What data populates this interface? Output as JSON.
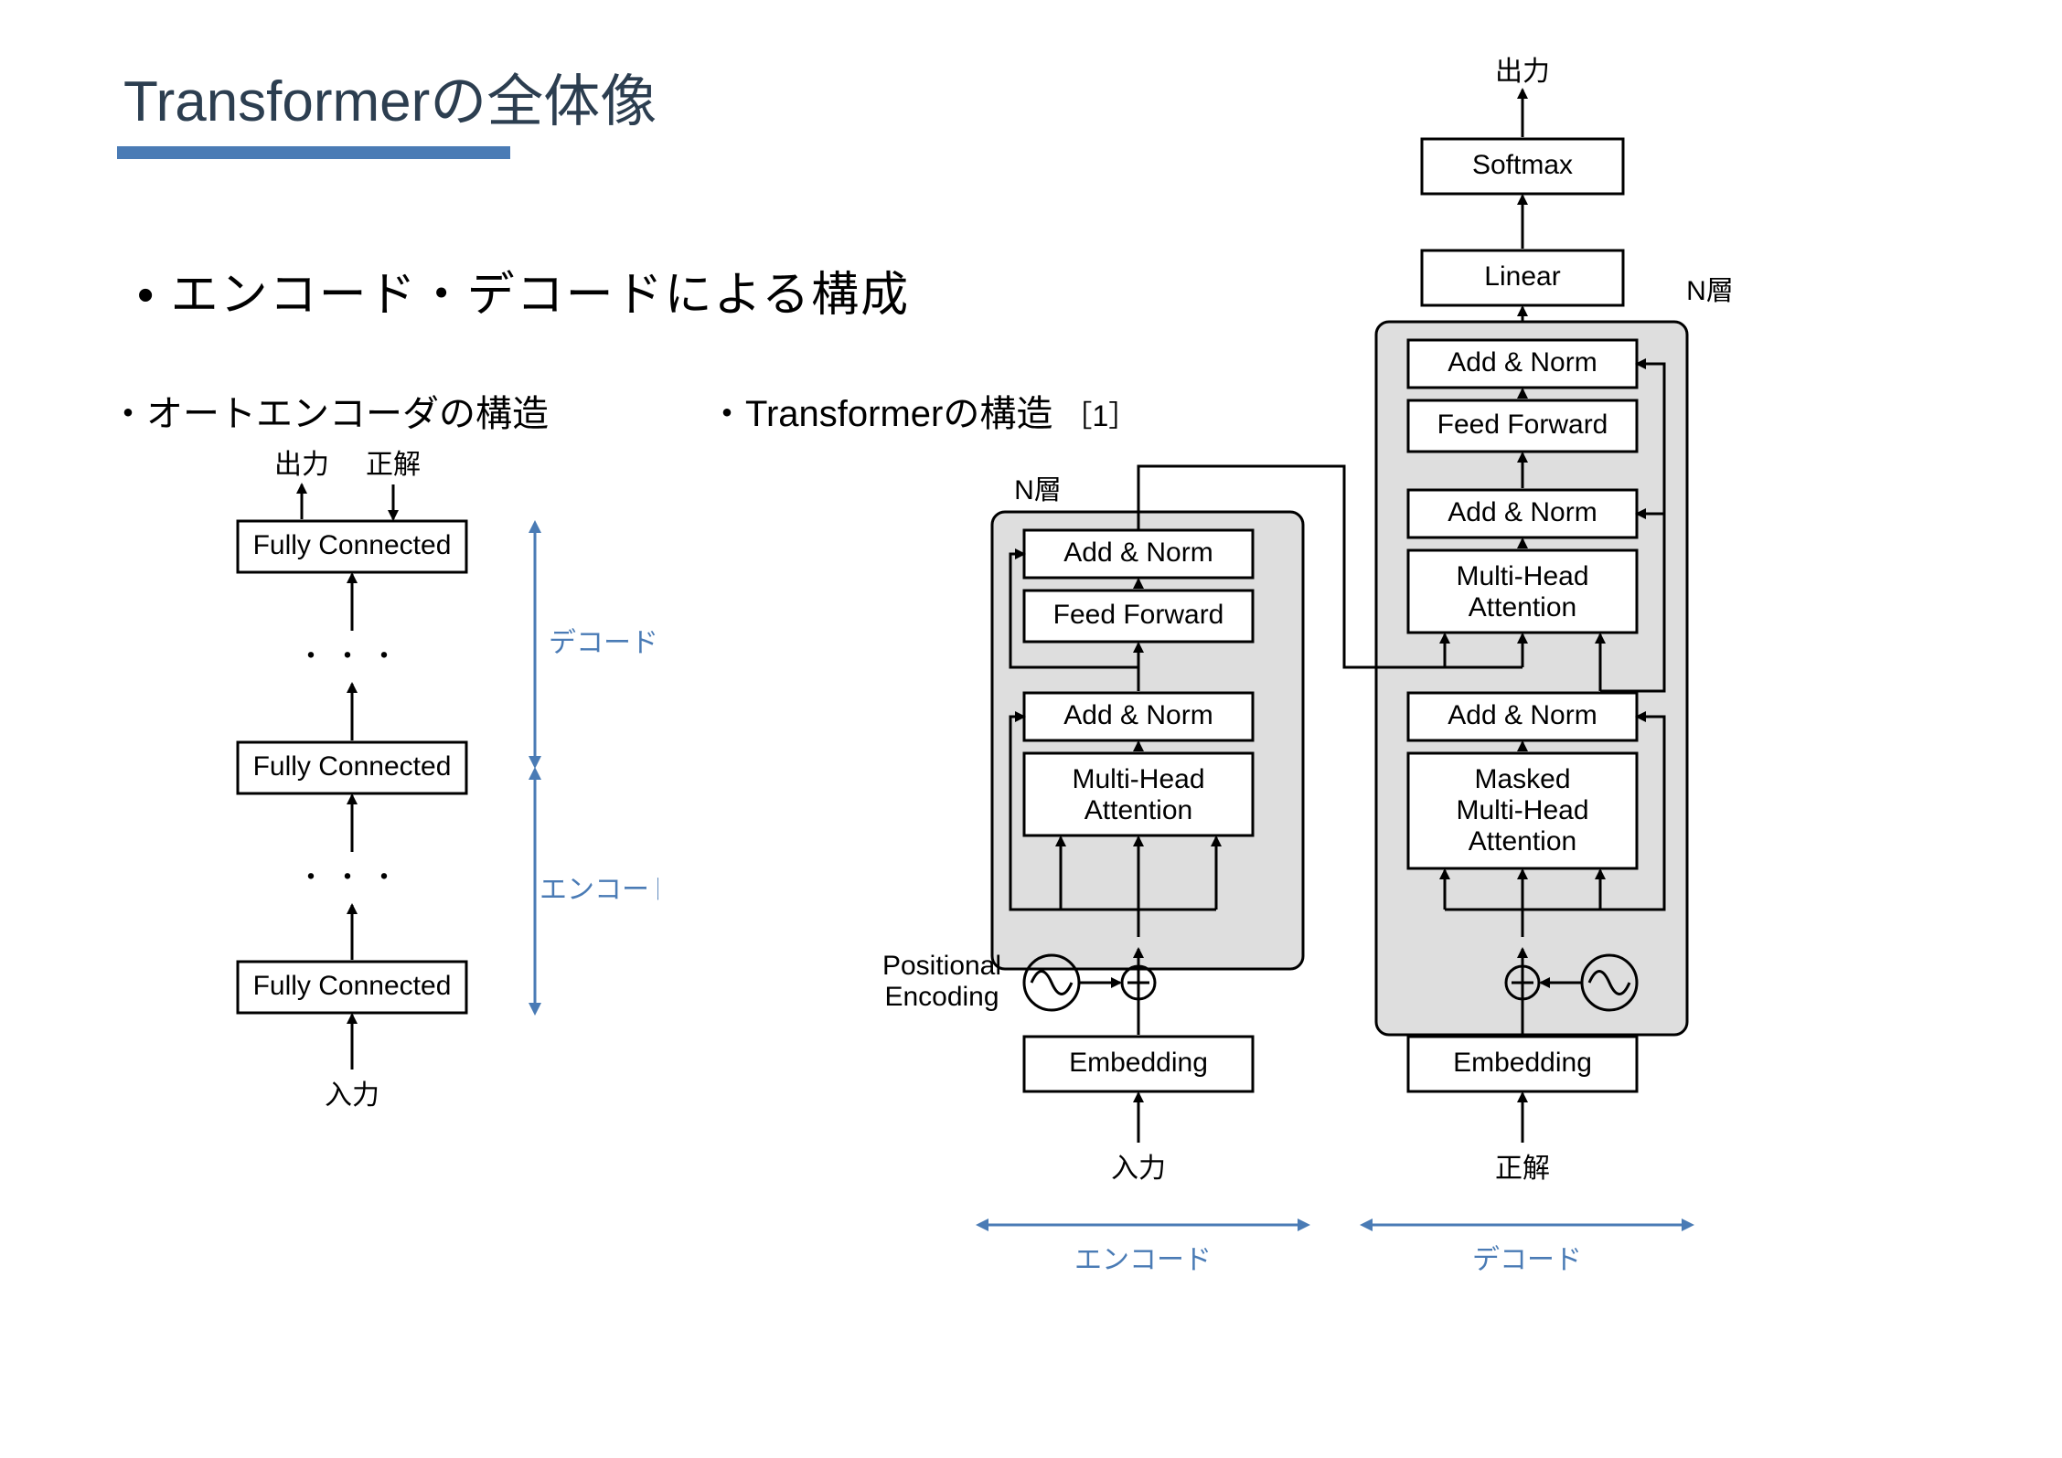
{
  "slide": {
    "title": "Transformerの全体像",
    "bullet": "エンコード・デコードによる構成",
    "sub_left": "・オートエンコーダの構造",
    "sub_right_a": "・Transformerの構造",
    "sub_right_ref": "［1］"
  },
  "ae": {
    "output_label": "出力",
    "target_label": "正解",
    "input_label": "入力",
    "fc": "Fully Connected",
    "dots": "・・・",
    "decode": "デコード",
    "encode": "エンコード"
  },
  "tf": {
    "n_layers_label": "N層",
    "addnorm": "Add & Norm",
    "ff": "Feed Forward",
    "mha1": "Multi-Head",
    "mha2": "Attention",
    "masked1": "Masked",
    "masked2": "Multi-Head",
    "masked3": "Attention",
    "embedding": "Embedding",
    "pe1": "Positional",
    "pe2": "Encoding",
    "softmax": "Softmax",
    "linear": "Linear",
    "output_label": "出力",
    "input_label": "入力",
    "target_label": "正解",
    "encode_lbl": "エンコード",
    "decode_lbl": "デコード"
  }
}
